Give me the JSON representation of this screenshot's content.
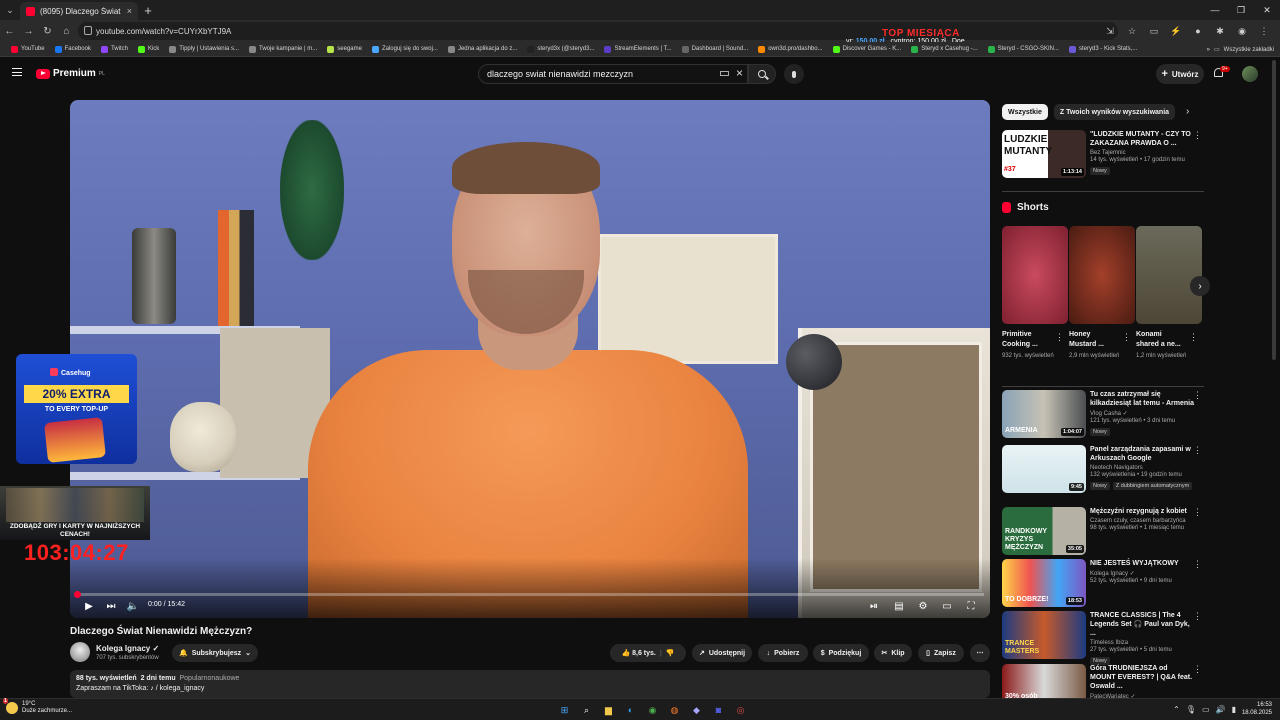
{
  "browser": {
    "tab_title": "(8095) Dlaczego Świat Nienawidzi Mężczyzn?",
    "tab_close": "×",
    "new_tab": "+",
    "url": "youtube.com/watch?v=CUYrXbYTJ9A",
    "bookmarks": [
      {
        "label": "YouTube",
        "color": "#ff0033"
      },
      {
        "label": "Facebook",
        "color": "#1877f2"
      },
      {
        "label": "Twitch",
        "color": "#9146ff"
      },
      {
        "label": "Kick",
        "color": "#53fc18"
      },
      {
        "label": "Tipply | Ustawienia s...",
        "color": "#888888"
      },
      {
        "label": "Twoje kampanie | m...",
        "color": "#888888"
      },
      {
        "label": "seegame",
        "color": "#b7e34b"
      },
      {
        "label": "Zaloguj się do swoj...",
        "color": "#4aa8ff"
      },
      {
        "label": "Jedna aplikacja do z...",
        "color": "#888888"
      },
      {
        "label": "steryd3x (@steryd3...",
        "color": "#222222"
      },
      {
        "label": "StreamElements | T...",
        "color": "#5b3cc4"
      },
      {
        "label": "Dashboard | Sound...",
        "color": "#666666"
      },
      {
        "label": "own3d.pro/dashbo...",
        "color": "#ff8a00"
      },
      {
        "label": "Discover Games - K...",
        "color": "#53fc18"
      },
      {
        "label": "Steryd x Casehug -...",
        "color": "#2ab24b"
      },
      {
        "label": "Steryd - CSGO-SKIN...",
        "color": "#2ab24b"
      },
      {
        "label": "steryd3 - Kick Stats,...",
        "color": "#6b5bd6"
      }
    ],
    "bookmarks_more": "»",
    "all_bookmarks": "Wszystkie zakładki"
  },
  "stream_overlay": {
    "top_label": "TOP MIESIĄCA",
    "money_left": "150,00 zł",
    "money_left_prefix": "vr:",
    "money_mid": "cyptron: 150,00 zł",
    "money_right": "Doe",
    "casehug_brand": "Casehug",
    "casehug_headline": "20% EXTRA",
    "casehug_sub": "TO EVERY TOP-UP",
    "promo_text": "ZDOBĄDŹ GRY I KARTY W NAJNIŻSZYCH CENACH!",
    "timer": "103:04:27"
  },
  "youtube": {
    "logo_text": "Premium",
    "logo_country": "PL",
    "search_value": "dlaczego swiat nienawidzi mezczyzn",
    "create_label": "Utwórz",
    "notif_badge": "9+",
    "player": {
      "time": "0:00 / 15:42",
      "progress": 0.0
    },
    "video": {
      "title": "Dlaczego Świat Nienawidzi Mężczyzn?",
      "channel": "Kolega Ignacy",
      "subs": "707 tys. subskrybentów",
      "subscribe_label": "Subskrybujesz",
      "likes": "8,6 tys.",
      "share": "Udostępnij",
      "download": "Pobierz",
      "thanks": "Podziękuj",
      "clip": "Klip",
      "save": "Zapisz",
      "views": "88 tys. wyświetleń",
      "age": "2 dni temu",
      "category": "Popularnonaukowe",
      "desc_line": "Zapraszam na TikToka: ♪ / kolega_ignacy"
    },
    "chips": [
      "Wszystkie",
      "Z Twoich wyników wyszukiwania"
    ],
    "top_video": {
      "title": "\"LUDZKIE MUTANTY - CZY TO ZAKAZANA PRAWDA O ...",
      "channel": "Bez Tajemnic",
      "meta": "14 tys. wyświetleń • 17 godzin temu",
      "badge": "Nowy",
      "duration": "1:13:14",
      "thumb_text": "LUDZKIE MUTANTY",
      "thumb_num": "#37"
    },
    "shorts_title": "Shorts",
    "shorts": [
      {
        "title": "Primitive Cooking ...",
        "views": "932 tys. wyświetleń"
      },
      {
        "title": "Honey Mustard ...",
        "views": "2,9 mln wyświetleń"
      },
      {
        "title": "Konami shared a ne...",
        "views": "1,2 mln wyświetleń"
      }
    ],
    "related": [
      {
        "title": "Tu czas zatrzymał się kilkadziesiąt lat temu - Armenia",
        "channel": "Vlog Casha ✓",
        "meta": "121 tys. wyświetleń • 3 dni temu",
        "badge": "Nowy",
        "duration": "1:04:07",
        "thumb_text": "ARMENIA"
      },
      {
        "title": "Panel zarządzania zapasami w Arkuszach Google",
        "channel": "Neotech Navigators",
        "meta": "132 wyświetlenia • 19 godzin temu",
        "badge": "Nowy",
        "badge2": "Z dubbingiem automatycznym",
        "duration": "9:45",
        "thumb_text": ""
      },
      {
        "title": "Mężczyźni rezygnują z kobiet",
        "channel": "Czasem czuły, czasem barbarzyńca",
        "meta": "98 tys. wyświetleń • 1 miesiąc temu",
        "duration": "35:05",
        "thumb_text": "RANDKOWY KRYZYS MĘŻCZYZN"
      },
      {
        "title": "NIE JESTEŚ WYJĄTKOWY",
        "channel": "Kolega Ignacy ✓",
        "meta": "52 tys. wyświetleń • 9 dni temu",
        "duration": "18:53",
        "thumb_text": "TO DOBRZE!"
      },
      {
        "title": "TRANCE CLASSICS | The 4 Legends Set 🎧 Paul van Dyk, ...",
        "channel": "Timeless Ibiza",
        "meta": "27 tys. wyświetleń • 5 dni temu",
        "badge": "Nowy",
        "duration": "",
        "thumb_text": "TRANCE MASTERS"
      },
      {
        "title": "Góra TRUDNIEJSZA od MOUNT EVEREST? | Q&A feat. Oswald ...",
        "channel": "PatecWariatec ✓",
        "meta": "",
        "duration": "",
        "thumb_text": "30% osób zdobywa"
      }
    ]
  },
  "taskbar": {
    "temp": "19°C",
    "weather": "Duże zachmurze...",
    "weather_badge": "1",
    "time": "16:53",
    "date": "18.08.2025"
  }
}
